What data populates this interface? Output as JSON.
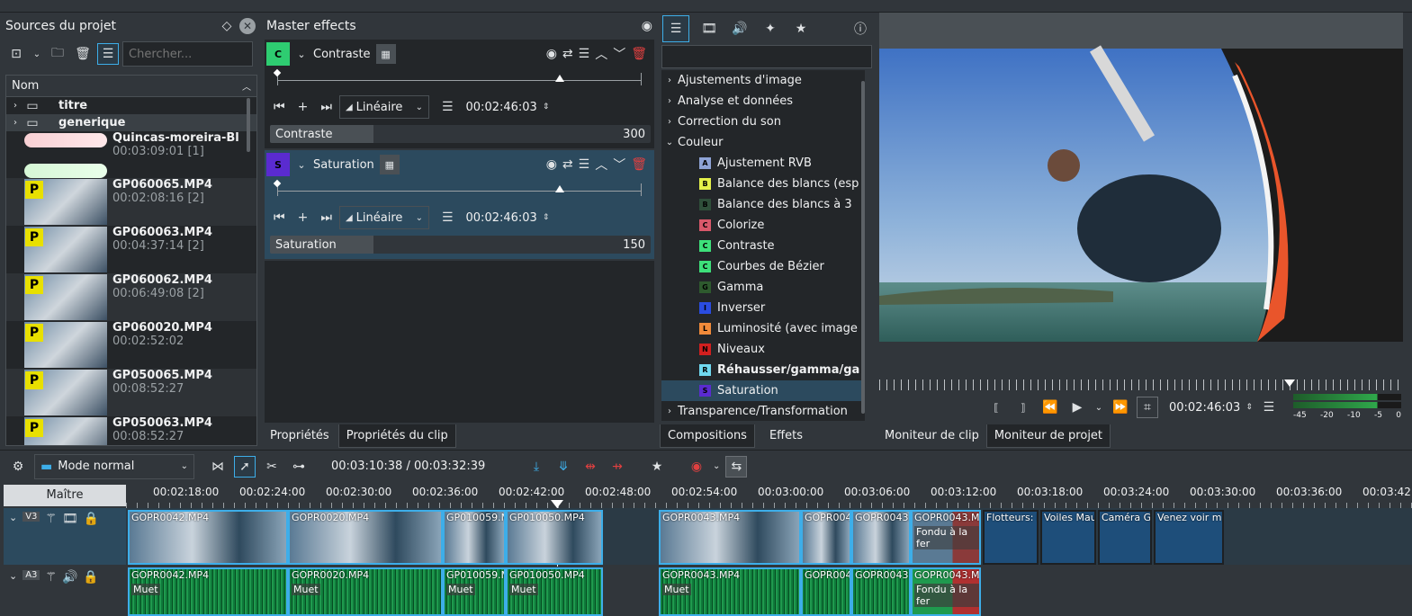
{
  "sources": {
    "title": "Sources du projet",
    "search_placeholder": "Chercher...",
    "column": "Nom",
    "folders": [
      {
        "name": "titre"
      },
      {
        "name": "generique"
      }
    ],
    "items": [
      {
        "name": "Quincas-moreira-Bl",
        "duration": "00:03:09:01 [1]"
      },
      {
        "name": "",
        "duration": ""
      },
      {
        "name": "GP060065.MP4",
        "duration": "00:02:08:16 [2]",
        "badge": "P"
      },
      {
        "name": "GP060063.MP4",
        "duration": "00:04:37:14 [2]",
        "badge": "P"
      },
      {
        "name": "GP060062.MP4",
        "duration": "00:06:49:08 [2]",
        "badge": "P"
      },
      {
        "name": "GP060020.MP4",
        "duration": "00:02:52:02",
        "badge": "P"
      },
      {
        "name": "GP050065.MP4",
        "duration": "00:08:52:27",
        "badge": "P"
      },
      {
        "name": "GP050063.MP4",
        "duration": "00:08:52:27",
        "badge": "P"
      }
    ]
  },
  "master": {
    "title": "Master effects",
    "effects": [
      {
        "letter": "C",
        "color": "#2ecc71",
        "name": "Contraste",
        "interp": "Linéaire",
        "timecode": "00:02:46:03",
        "param": "Contraste",
        "value": "300"
      },
      {
        "letter": "S",
        "color": "#5a2bd0",
        "name": "Saturation",
        "interp": "Linéaire",
        "timecode": "00:02:46:03",
        "param": "Saturation",
        "value": "150"
      }
    ]
  },
  "effects_list": {
    "categories_top": [
      "Ajustements d'image",
      "Analyse et données",
      "Correction du son"
    ],
    "open_category": "Couleur",
    "items": [
      {
        "letter": "A",
        "color": "#8ea3d6",
        "name": "Ajustement RVB"
      },
      {
        "letter": "B",
        "color": "#e4f04a",
        "name": "Balance des blancs (esp"
      },
      {
        "letter": "B",
        "color": "#2f4f3a",
        "name": "Balance des blancs à 3"
      },
      {
        "letter": "C",
        "color": "#d9586a",
        "name": "Colorize"
      },
      {
        "letter": "C",
        "color": "#3de07a",
        "name": "Contraste"
      },
      {
        "letter": "C",
        "color": "#3de07a",
        "name": "Courbes de Bézier"
      },
      {
        "letter": "G",
        "color": "#2e5a2e",
        "name": "Gamma"
      },
      {
        "letter": "I",
        "color": "#2a4ce0",
        "name": "Inverser"
      },
      {
        "letter": "L",
        "color": "#f08a3a",
        "name": "Luminosité (avec image"
      },
      {
        "letter": "N",
        "color": "#d11f1f",
        "name": "Niveaux"
      },
      {
        "letter": "R",
        "color": "#6fd8ef",
        "name": "Réhausser/gamma/ga"
      },
      {
        "letter": "S",
        "color": "#5a2bd0",
        "name": "Saturation"
      }
    ],
    "categories_bottom": [
      "Transparence/Transformation"
    ]
  },
  "tabs_left": [
    "Propriétés",
    "Propriétés du clip"
  ],
  "tabs_mid": [
    "Compositions",
    "Effets"
  ],
  "tabs_right": [
    "Moniteur de clip",
    "Moniteur de projet"
  ],
  "monitor": {
    "timecode": "00:02:46:03",
    "meter_labels": [
      "-45",
      "-20",
      "-10",
      "-5",
      "0"
    ]
  },
  "timeline": {
    "mode": "Mode normal",
    "position": "00:03:10:38 / 00:03:32:39",
    "master_label": "Maître",
    "ruler": [
      "00:02:18:00",
      "00:02:24:00",
      "00:02:30:00",
      "00:02:36:00",
      "00:02:42:00",
      "00:02:48:00",
      "00:02:54:00",
      "00:03:00:00",
      "00:03:06:00",
      "00:03:12:00",
      "00:03:18:00",
      "00:03:24:00",
      "00:03:30:00",
      "00:03:36:00",
      "00:03:42:0"
    ],
    "v_track": "V3",
    "a_track": "A3",
    "video_clips": [
      "GOPR0042.MP4",
      "GOPR0020.MP4",
      "GP010059.M",
      "GP010050.MP4",
      "GOPR0043.MP4",
      "GOPR004",
      "GOPR0043.",
      "GOPR0043.MP"
    ],
    "title_clips": [
      "Flotteurs: F",
      "Voiles Mau",
      "Caméra Go",
      "Venez voir m."
    ],
    "audio_clips": [
      "GOPR0042.MP4",
      "GOPR0020.MP4",
      "GP010059.M",
      "GP010050.MP4",
      "GOPR0043.MP4",
      "GOPR004",
      "GOPR0043.",
      "GOPR0043.MP"
    ],
    "muet": "Muet",
    "fade": "Fondu à la fer"
  }
}
